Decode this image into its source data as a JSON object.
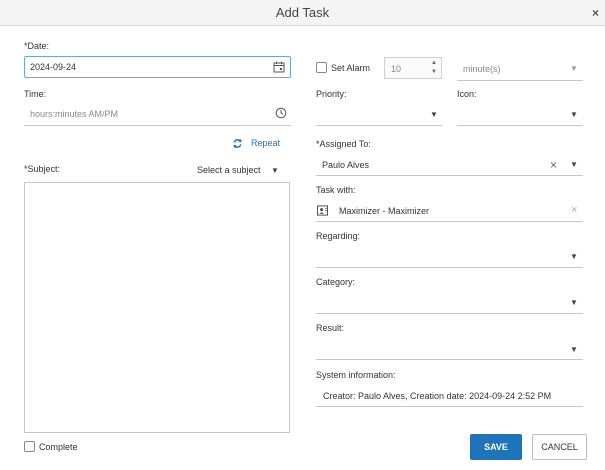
{
  "dialog": {
    "title": "Add Task",
    "close_glyph": "×"
  },
  "left": {
    "date_label": "*Date:",
    "date_value": "2024-09-24",
    "time_label": "Time:",
    "time_placeholder": "hours:minutes AM/PM",
    "repeat_label": "Repeat",
    "subject_label": "*Subject:",
    "subject_select": "Select a subject",
    "complete_label": "Complete"
  },
  "alarm": {
    "set_alarm_label": "Set Alarm",
    "stepper_value": "10",
    "unit_value": "minute(s)"
  },
  "right": {
    "priority_label": "Priority:",
    "icon_label": "Icon:",
    "assigned_label": "*Assigned To:",
    "assigned_value": "Paulo Alves",
    "task_with_label": "Task with:",
    "task_with_value": "Maximizer - Maximizer",
    "regarding_label": "Regarding:",
    "category_label": "Category:",
    "result_label": "Result:",
    "sysinfo_label": "System information:",
    "sysinfo_value": "Creator: Paulo Alves, Creation date: 2024-09-24 2:52 PM"
  },
  "buttons": {
    "save": "SAVE",
    "cancel": "CANCEL"
  },
  "icons": {
    "calendar": "calendar-icon",
    "clock": "clock-icon",
    "repeat": "refresh-icon",
    "contact": "contact-card-icon"
  },
  "colors": {
    "primary": "#1f73b7",
    "focus_border": "#6aa7d8"
  }
}
